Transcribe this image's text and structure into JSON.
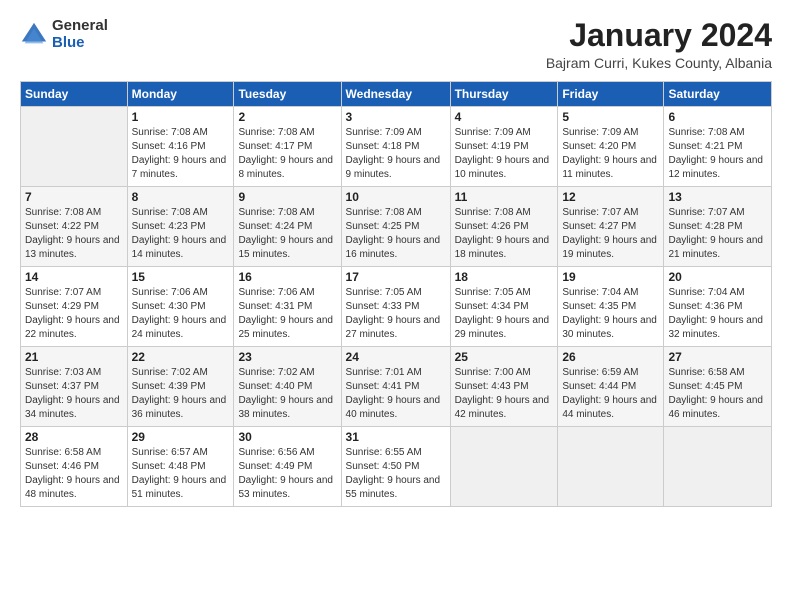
{
  "header": {
    "logo_general": "General",
    "logo_blue": "Blue",
    "month_title": "January 2024",
    "location": "Bajram Curri, Kukes County, Albania"
  },
  "weekdays": [
    "Sunday",
    "Monday",
    "Tuesday",
    "Wednesday",
    "Thursday",
    "Friday",
    "Saturday"
  ],
  "weeks": [
    [
      {
        "day": "",
        "sunrise": "",
        "sunset": "",
        "daylight": ""
      },
      {
        "day": "1",
        "sunrise": "Sunrise: 7:08 AM",
        "sunset": "Sunset: 4:16 PM",
        "daylight": "Daylight: 9 hours and 7 minutes."
      },
      {
        "day": "2",
        "sunrise": "Sunrise: 7:08 AM",
        "sunset": "Sunset: 4:17 PM",
        "daylight": "Daylight: 9 hours and 8 minutes."
      },
      {
        "day": "3",
        "sunrise": "Sunrise: 7:09 AM",
        "sunset": "Sunset: 4:18 PM",
        "daylight": "Daylight: 9 hours and 9 minutes."
      },
      {
        "day": "4",
        "sunrise": "Sunrise: 7:09 AM",
        "sunset": "Sunset: 4:19 PM",
        "daylight": "Daylight: 9 hours and 10 minutes."
      },
      {
        "day": "5",
        "sunrise": "Sunrise: 7:09 AM",
        "sunset": "Sunset: 4:20 PM",
        "daylight": "Daylight: 9 hours and 11 minutes."
      },
      {
        "day": "6",
        "sunrise": "Sunrise: 7:08 AM",
        "sunset": "Sunset: 4:21 PM",
        "daylight": "Daylight: 9 hours and 12 minutes."
      }
    ],
    [
      {
        "day": "7",
        "sunrise": "Sunrise: 7:08 AM",
        "sunset": "Sunset: 4:22 PM",
        "daylight": "Daylight: 9 hours and 13 minutes."
      },
      {
        "day": "8",
        "sunrise": "Sunrise: 7:08 AM",
        "sunset": "Sunset: 4:23 PM",
        "daylight": "Daylight: 9 hours and 14 minutes."
      },
      {
        "day": "9",
        "sunrise": "Sunrise: 7:08 AM",
        "sunset": "Sunset: 4:24 PM",
        "daylight": "Daylight: 9 hours and 15 minutes."
      },
      {
        "day": "10",
        "sunrise": "Sunrise: 7:08 AM",
        "sunset": "Sunset: 4:25 PM",
        "daylight": "Daylight: 9 hours and 16 minutes."
      },
      {
        "day": "11",
        "sunrise": "Sunrise: 7:08 AM",
        "sunset": "Sunset: 4:26 PM",
        "daylight": "Daylight: 9 hours and 18 minutes."
      },
      {
        "day": "12",
        "sunrise": "Sunrise: 7:07 AM",
        "sunset": "Sunset: 4:27 PM",
        "daylight": "Daylight: 9 hours and 19 minutes."
      },
      {
        "day": "13",
        "sunrise": "Sunrise: 7:07 AM",
        "sunset": "Sunset: 4:28 PM",
        "daylight": "Daylight: 9 hours and 21 minutes."
      }
    ],
    [
      {
        "day": "14",
        "sunrise": "Sunrise: 7:07 AM",
        "sunset": "Sunset: 4:29 PM",
        "daylight": "Daylight: 9 hours and 22 minutes."
      },
      {
        "day": "15",
        "sunrise": "Sunrise: 7:06 AM",
        "sunset": "Sunset: 4:30 PM",
        "daylight": "Daylight: 9 hours and 24 minutes."
      },
      {
        "day": "16",
        "sunrise": "Sunrise: 7:06 AM",
        "sunset": "Sunset: 4:31 PM",
        "daylight": "Daylight: 9 hours and 25 minutes."
      },
      {
        "day": "17",
        "sunrise": "Sunrise: 7:05 AM",
        "sunset": "Sunset: 4:33 PM",
        "daylight": "Daylight: 9 hours and 27 minutes."
      },
      {
        "day": "18",
        "sunrise": "Sunrise: 7:05 AM",
        "sunset": "Sunset: 4:34 PM",
        "daylight": "Daylight: 9 hours and 29 minutes."
      },
      {
        "day": "19",
        "sunrise": "Sunrise: 7:04 AM",
        "sunset": "Sunset: 4:35 PM",
        "daylight": "Daylight: 9 hours and 30 minutes."
      },
      {
        "day": "20",
        "sunrise": "Sunrise: 7:04 AM",
        "sunset": "Sunset: 4:36 PM",
        "daylight": "Daylight: 9 hours and 32 minutes."
      }
    ],
    [
      {
        "day": "21",
        "sunrise": "Sunrise: 7:03 AM",
        "sunset": "Sunset: 4:37 PM",
        "daylight": "Daylight: 9 hours and 34 minutes."
      },
      {
        "day": "22",
        "sunrise": "Sunrise: 7:02 AM",
        "sunset": "Sunset: 4:39 PM",
        "daylight": "Daylight: 9 hours and 36 minutes."
      },
      {
        "day": "23",
        "sunrise": "Sunrise: 7:02 AM",
        "sunset": "Sunset: 4:40 PM",
        "daylight": "Daylight: 9 hours and 38 minutes."
      },
      {
        "day": "24",
        "sunrise": "Sunrise: 7:01 AM",
        "sunset": "Sunset: 4:41 PM",
        "daylight": "Daylight: 9 hours and 40 minutes."
      },
      {
        "day": "25",
        "sunrise": "Sunrise: 7:00 AM",
        "sunset": "Sunset: 4:43 PM",
        "daylight": "Daylight: 9 hours and 42 minutes."
      },
      {
        "day": "26",
        "sunrise": "Sunrise: 6:59 AM",
        "sunset": "Sunset: 4:44 PM",
        "daylight": "Daylight: 9 hours and 44 minutes."
      },
      {
        "day": "27",
        "sunrise": "Sunrise: 6:58 AM",
        "sunset": "Sunset: 4:45 PM",
        "daylight": "Daylight: 9 hours and 46 minutes."
      }
    ],
    [
      {
        "day": "28",
        "sunrise": "Sunrise: 6:58 AM",
        "sunset": "Sunset: 4:46 PM",
        "daylight": "Daylight: 9 hours and 48 minutes."
      },
      {
        "day": "29",
        "sunrise": "Sunrise: 6:57 AM",
        "sunset": "Sunset: 4:48 PM",
        "daylight": "Daylight: 9 hours and 51 minutes."
      },
      {
        "day": "30",
        "sunrise": "Sunrise: 6:56 AM",
        "sunset": "Sunset: 4:49 PM",
        "daylight": "Daylight: 9 hours and 53 minutes."
      },
      {
        "day": "31",
        "sunrise": "Sunrise: 6:55 AM",
        "sunset": "Sunset: 4:50 PM",
        "daylight": "Daylight: 9 hours and 55 minutes."
      },
      {
        "day": "",
        "sunrise": "",
        "sunset": "",
        "daylight": ""
      },
      {
        "day": "",
        "sunrise": "",
        "sunset": "",
        "daylight": ""
      },
      {
        "day": "",
        "sunrise": "",
        "sunset": "",
        "daylight": ""
      }
    ]
  ]
}
